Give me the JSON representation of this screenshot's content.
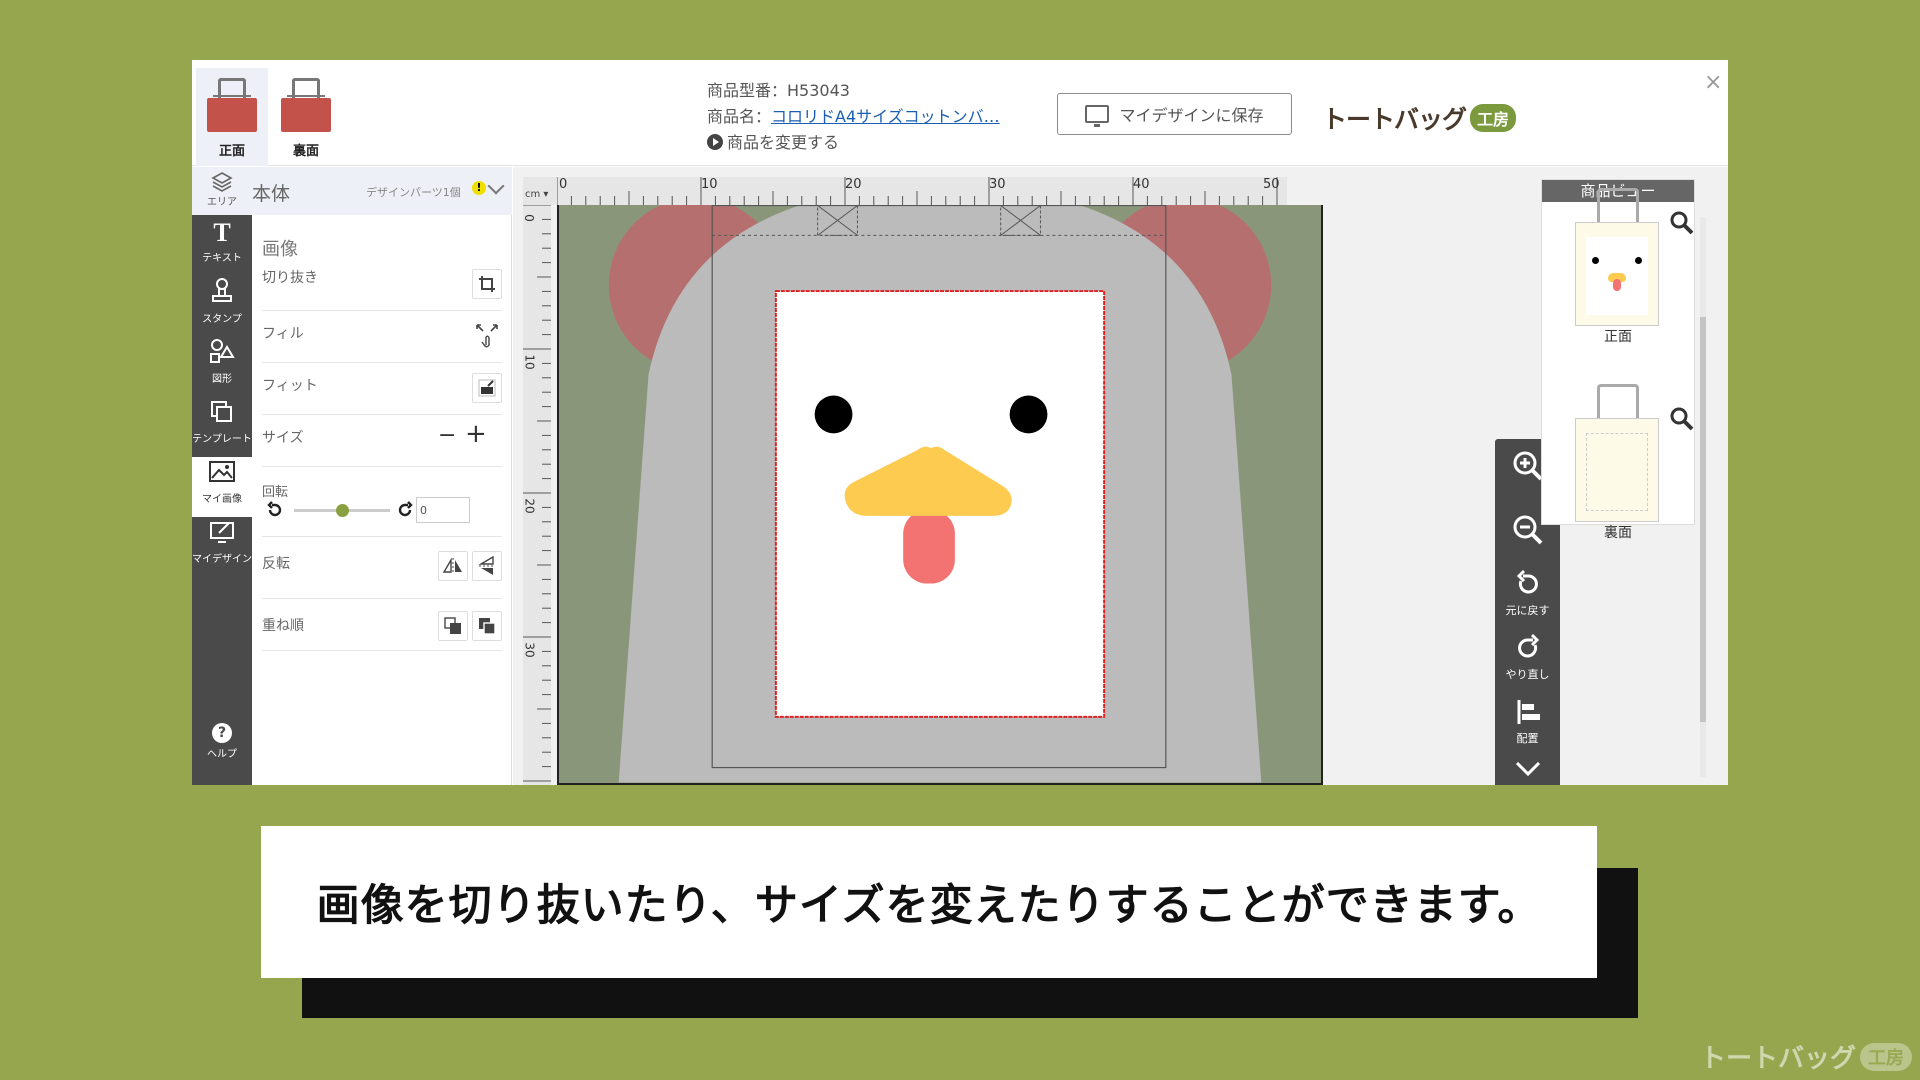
{
  "tabs": [
    {
      "label": "正面",
      "active": true
    },
    {
      "label": "裏面",
      "active": false
    }
  ],
  "product": {
    "code": "商品型番：H53043",
    "name_label": "商品名：",
    "name_link": "コロリドA4サイズコットンバ…",
    "change": "商品を変更する"
  },
  "save_button": "マイデザインに保存",
  "brand": {
    "name": "トートバッグ",
    "badge": "工房"
  },
  "close": "×",
  "rail": {
    "area": "エリア",
    "items": [
      "テキスト",
      "スタンプ",
      "図形",
      "テンプレート",
      "マイ画像",
      "マイデザイン"
    ],
    "help": "ヘルプ"
  },
  "panel": {
    "head": "本体",
    "head_sub": "デザインパーツ1個",
    "warn": "!",
    "section": "画像",
    "crop": "切り抜き",
    "fill": "フィル",
    "fit": "フィット",
    "size": "サイズ",
    "size_minus": "−",
    "size_plus": "+",
    "rotate": "回転",
    "rotate_value": "0",
    "flip": "反転",
    "order": "重ね順"
  },
  "ruler": {
    "unit": "cm",
    "h_labels": [
      "0",
      "10",
      "20",
      "30",
      "40",
      "50"
    ],
    "v_labels": [
      "0",
      "10",
      "20",
      "30"
    ]
  },
  "tools": {
    "undo": "元に戻す",
    "redo": "やり直し",
    "align": "配置"
  },
  "preview": {
    "title": "商品ビュー",
    "front": "正面",
    "back": "裏面"
  },
  "caption": "画像を切り抜いたり、サイズを変えたりすることができます。",
  "watermark": {
    "name": "トートバッグ",
    "badge": "工房"
  },
  "colors": {
    "background": "#95a64e",
    "bag": "#c3534a",
    "canvas": "#8a967a",
    "beak": "#fccb4f",
    "tongue": "#f37373",
    "ear": "#b56f6f"
  }
}
